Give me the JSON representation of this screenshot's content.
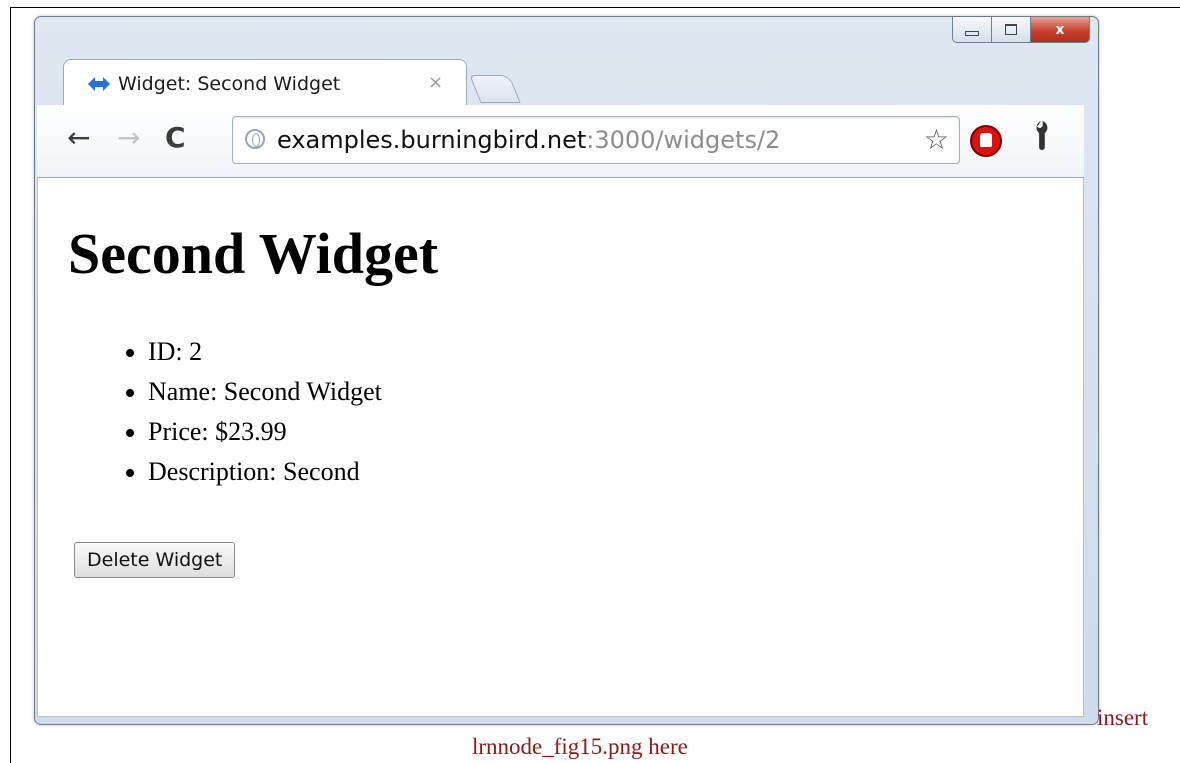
{
  "window": {
    "tab_title": "Widget: Second Widget",
    "tab_close": "×",
    "url_host": "examples.burningbird.net",
    "url_path": ":3000/widgets/2",
    "icons": {
      "back": "←",
      "forward": "→",
      "reload": "C",
      "star": "☆",
      "wrench": "🔧",
      "close": "x"
    }
  },
  "page": {
    "title": "Second Widget",
    "details": [
      "ID: 2",
      "Name: Second Widget",
      "Price: $23.99",
      "Description: Second"
    ],
    "delete_button": "Delete Widget"
  },
  "caption": {
    "line1": "insert",
    "line2": "lrnnode_fig15.png here"
  },
  "colors": {
    "caption": "#8b1a1a",
    "close_button": "#c7402e",
    "favicon": "#1f74d6"
  }
}
